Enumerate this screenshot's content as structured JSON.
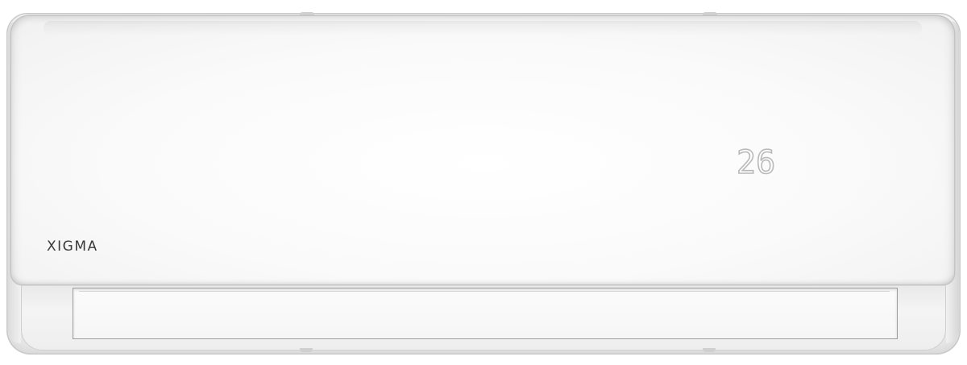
{
  "unit": {
    "brand_logo": "XIGMA",
    "temperature_display": "26"
  },
  "colors": {
    "body": "#f3f3f3",
    "panel": "#fafafa",
    "outline": "#c4c4c4",
    "brand_text": "#3a3a3a",
    "display_digits": "#b9b9b9"
  }
}
